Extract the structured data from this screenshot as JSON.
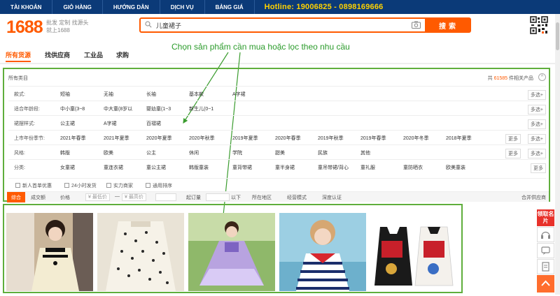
{
  "topnav": {
    "items": [
      "TÀI KHOẢN",
      "GIỎ HÀNG",
      "HƯỚNG DẪN",
      "DỊCH VỤ",
      "BẢNG GIÁ"
    ],
    "hotline": "Hotline: 19006825 - 0898169666"
  },
  "header": {
    "logo": "1688",
    "slogan": "批发 定制 找源头 就上1688",
    "search_value": "儿童裙子",
    "search_button": "搜索"
  },
  "tabs": [
    "所有货源",
    "找供应商",
    "工业品",
    "求购"
  ],
  "annotation": "Chọn sản phẩm cần mua hoặc lọc theo nhu cầu",
  "filter": {
    "all_categories": "所有类目",
    "count_prefix": "共",
    "count": "61585",
    "count_suffix": "件相关产品",
    "collapse": "^",
    "multi_label": "多选+",
    "more_label": "更多",
    "rows": [
      {
        "label": "款式:",
        "options": [
          "短袖",
          "无袖",
          "长袖",
          "基本款",
          "A字裙"
        ],
        "more": false,
        "multi": true
      },
      {
        "label": "适合年龄段:",
        "options": [
          "中小童(3~8",
          "中大童(8岁以",
          "婴幼童(1~3",
          "新生儿(0~1"
        ],
        "more": false,
        "multi": true
      },
      {
        "label": "裙摆样式:",
        "options": [
          "公主裙",
          "A字裙",
          "百褶裙"
        ],
        "more": false,
        "multi": true
      },
      {
        "label": "上市年份季节:",
        "options": [
          "2021年春季",
          "2021年夏季",
          "2020年夏季",
          "2020年秋季",
          "2019年夏季",
          "2020年春季",
          "2019年秋季",
          "2019年春季",
          "2020年冬季",
          "2018年夏季"
        ],
        "more": true,
        "multi": true
      },
      {
        "label": "风格:",
        "options": [
          "韩版",
          "欧美",
          "公主",
          "休闲",
          "学院",
          "甜美",
          "民族",
          "其他"
        ],
        "more": true,
        "multi": true
      },
      {
        "label": "分类:",
        "options": [
          "女童裙",
          "童连衣裙",
          "童公主裙",
          "韩版童装",
          "童背带裙",
          "童半身裙",
          "童吊带裙/背心",
          "童礼服",
          "童防晒衣",
          "欧美童装"
        ],
        "more": false,
        "multi": false,
        "more_only": true
      }
    ],
    "checks": [
      "新人首单优惠",
      "24小时发货",
      "实力商家",
      "通用排序"
    ],
    "sort": {
      "active": "综合",
      "items": [
        "成交额",
        "价格",
        "¥ 最低价",
        "—",
        "¥ 最高价",
        "起订量",
        "以下",
        "所在地区",
        "经营模式",
        "深度认证"
      ],
      "merge": "合并供应商"
    }
  },
  "sidebar": {
    "red_label": "领取名片"
  },
  "colors": {
    "accent": "#ff5a00",
    "nav": "#0b3a78",
    "hotline": "#ffd200",
    "annotation": "#2b9b2b"
  }
}
